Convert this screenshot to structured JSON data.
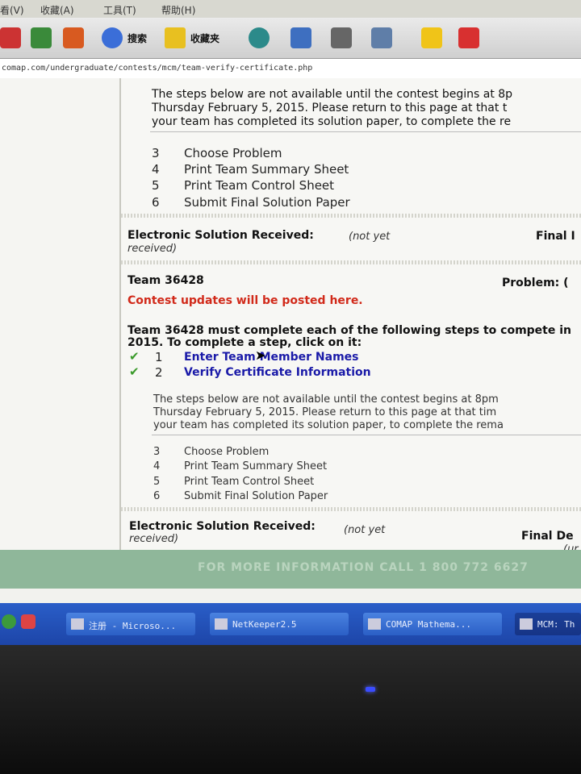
{
  "menu": [
    "看(V)",
    "收藏(A)",
    "工具(T)",
    "帮助(H)"
  ],
  "toolbar": {
    "search_label": "搜索",
    "favorites_label": "收藏夹"
  },
  "address": {
    "url": "comap.com/undergraduate/contests/mcm/team-verify-certificate.php"
  },
  "top_block": {
    "notice_lines": [
      "The steps below are not available until the contest begins at 8p",
      "Thursday February 5, 2015. Please return to this page at that t",
      "your team has completed its solution paper, to complete the re"
    ],
    "steps": [
      {
        "num": "3",
        "label": "Choose Problem"
      },
      {
        "num": "4",
        "label": "Print Team Summary Sheet"
      },
      {
        "num": "5",
        "label": "Print Team Control Sheet"
      },
      {
        "num": "6",
        "label": "Submit Final Solution Paper"
      }
    ],
    "esr_label": "Electronic Solution Received:",
    "esr_value": "(not yet",
    "esr_value2": "received)",
    "final_label": "Final I"
  },
  "team_block": {
    "team_title": "Team 36428",
    "problem_label": "Problem: (",
    "updates": "Contest updates will be posted here.",
    "intro_line1": "Team 36428 must complete each of the following steps to compete in",
    "intro_line2": "2015. To complete a step, click on it:",
    "done_steps": [
      {
        "num": "1",
        "label": "Enter Team Member Names"
      },
      {
        "num": "2",
        "label": "Verify Certificate Information"
      }
    ],
    "notice_lines": [
      "The steps below are not available until the contest begins at 8pm",
      "Thursday February 5, 2015. Please return to this page at that tim",
      "your team has completed its solution paper, to complete the rema"
    ],
    "steps": [
      {
        "num": "3",
        "label": "Choose Problem"
      },
      {
        "num": "4",
        "label": "Print Team Summary Sheet"
      },
      {
        "num": "5",
        "label": "Print Team Control Sheet"
      },
      {
        "num": "6",
        "label": "Submit Final Solution Paper"
      }
    ],
    "esr_label": "Electronic Solution Received:",
    "esr_value": "(not yet",
    "esr_value2": "received)",
    "final_label": "Final De",
    "final_value": "(ur"
  },
  "footer": {
    "text": "FOR MORE INFORMATION CALL 1 800 772 6627"
  },
  "taskbar": [
    {
      "label": "注册 - Microso..."
    },
    {
      "label": "NetKeeper2.5"
    },
    {
      "label": "COMAP  Mathema..."
    },
    {
      "label": "MCM: Th"
    }
  ]
}
